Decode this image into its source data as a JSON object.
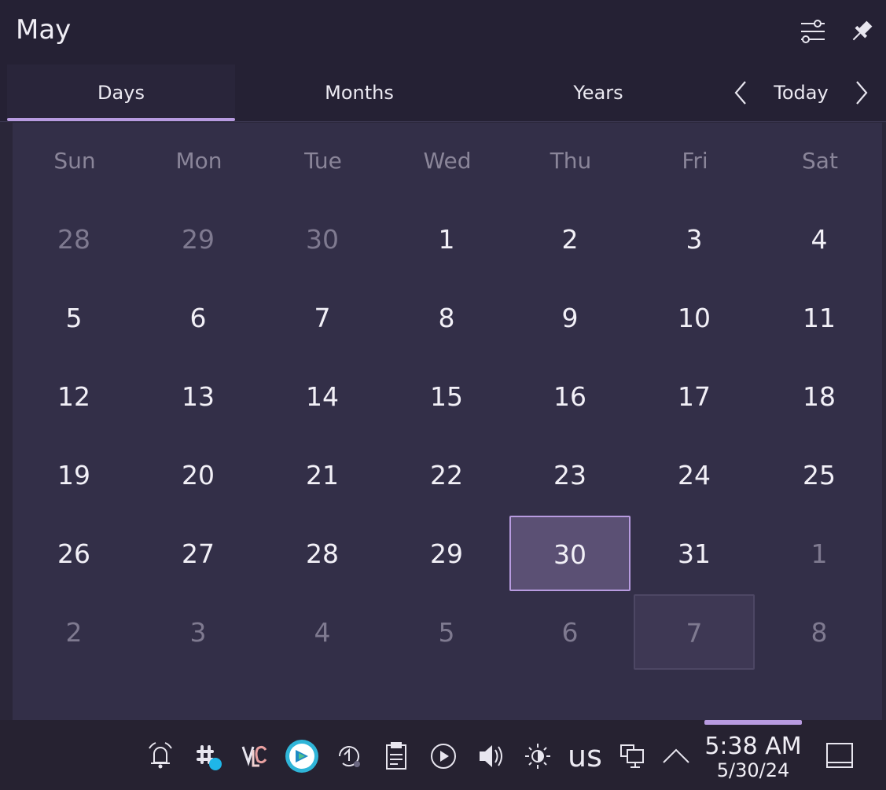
{
  "header": {
    "title": "May"
  },
  "tabs": [
    {
      "label": "Days",
      "active": true
    },
    {
      "label": "Months",
      "active": false
    },
    {
      "label": "Years",
      "active": false
    }
  ],
  "nav": {
    "today_label": "Today"
  },
  "weekdays": [
    "Sun",
    "Mon",
    "Tue",
    "Wed",
    "Thu",
    "Fri",
    "Sat"
  ],
  "weeks": [
    [
      {
        "d": "28",
        "o": true
      },
      {
        "d": "29",
        "o": true
      },
      {
        "d": "30",
        "o": true
      },
      {
        "d": "1"
      },
      {
        "d": "2"
      },
      {
        "d": "3"
      },
      {
        "d": "4"
      }
    ],
    [
      {
        "d": "5"
      },
      {
        "d": "6"
      },
      {
        "d": "7"
      },
      {
        "d": "8"
      },
      {
        "d": "9"
      },
      {
        "d": "10"
      },
      {
        "d": "11"
      }
    ],
    [
      {
        "d": "12"
      },
      {
        "d": "13"
      },
      {
        "d": "14"
      },
      {
        "d": "15"
      },
      {
        "d": "16"
      },
      {
        "d": "17"
      },
      {
        "d": "18"
      }
    ],
    [
      {
        "d": "19"
      },
      {
        "d": "20"
      },
      {
        "d": "21"
      },
      {
        "d": "22"
      },
      {
        "d": "23"
      },
      {
        "d": "24"
      },
      {
        "d": "25"
      }
    ],
    [
      {
        "d": "26"
      },
      {
        "d": "27"
      },
      {
        "d": "28"
      },
      {
        "d": "29"
      },
      {
        "d": "30",
        "today": true
      },
      {
        "d": "31"
      },
      {
        "d": "1",
        "o": true
      }
    ],
    [
      {
        "d": "2",
        "o": true
      },
      {
        "d": "3",
        "o": true
      },
      {
        "d": "4",
        "o": true
      },
      {
        "d": "5",
        "o": true
      },
      {
        "d": "6",
        "o": true
      },
      {
        "d": "7",
        "o": true,
        "hover": true
      },
      {
        "d": "8",
        "o": true
      }
    ]
  ],
  "taskbar": {
    "keyboard_layout": "us",
    "clock_time": "5:38 AM",
    "clock_date": "5/30/24",
    "tray_icons": [
      "notifications-bell-icon",
      "slack-icon",
      "vlc-icon",
      "remote-desktop-icon",
      "update-icon",
      "clipboard-icon",
      "media-player-icon",
      "volume-icon",
      "brightness-icon",
      "network-icon",
      "expand-tray-chevron-icon"
    ]
  },
  "colors": {
    "accent": "#b89be0",
    "today_bg": "#5b5074",
    "grid_bg": "#332f48",
    "header_bg": "#252134"
  }
}
